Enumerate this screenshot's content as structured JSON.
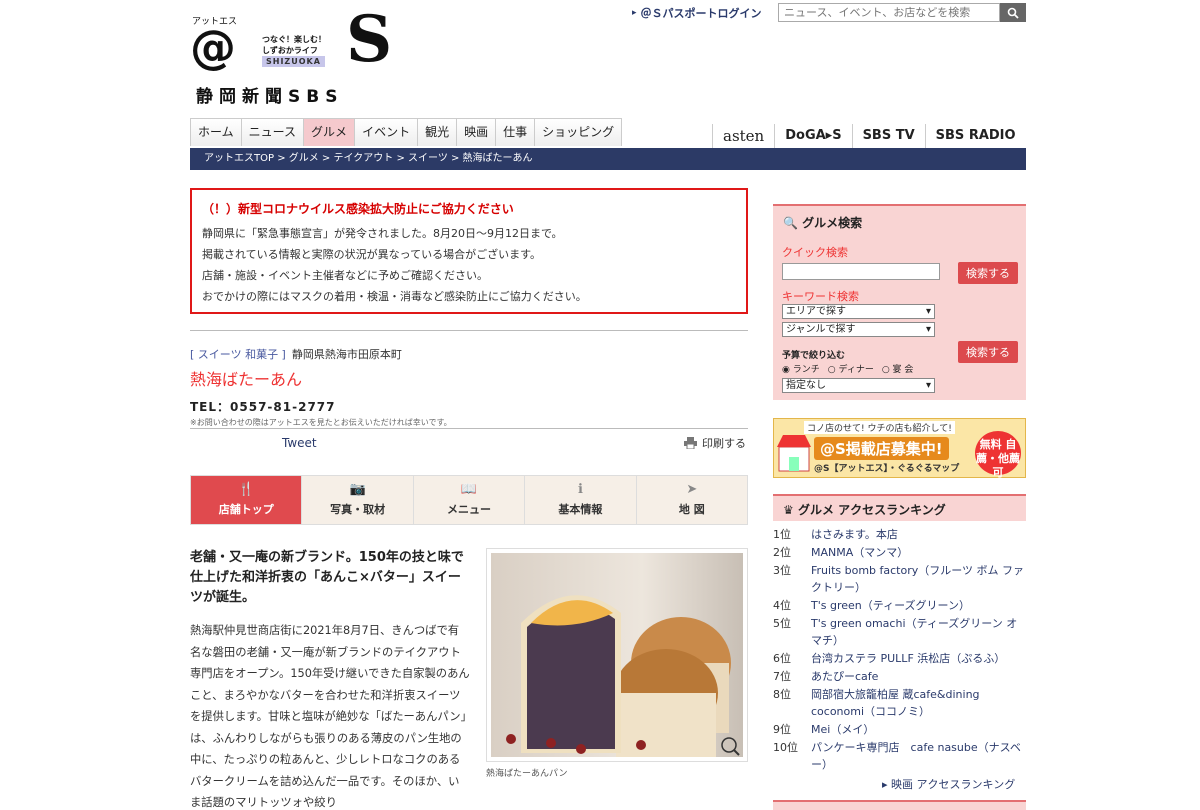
{
  "header": {
    "logo_at_small": "アットエス",
    "logo_at": "@",
    "tagline": "つなぐ！楽しむ！しずおかライフ",
    "logo_shizuoka": "SHIZUOKA",
    "logo_big_s": "S",
    "logo_sub": "静岡新聞SBS",
    "passport_link": "＠Ｓパスポートログイン",
    "search_placeholder": "ニュース、イベント、お店などを検索"
  },
  "nav": [
    "ホーム",
    "ニュース",
    "グルメ",
    "イベント",
    "観光",
    "映画",
    "仕事",
    "ショッピング"
  ],
  "nav_active": "グルメ",
  "media_links": [
    "asten",
    "DoGA▸S",
    "SBS TV",
    "SBS RADIO"
  ],
  "breadcrumb": "アットエスTOP > グルメ > テイクアウト > スイーツ > 熱海ばたーあん",
  "notice": {
    "title": "（！）新型コロナウイルス感染拡大防止にご協力ください",
    "lines": [
      "静岡県に「緊急事態宣言」が発令されました。8月20日〜9月12日まで。",
      "掲載されている情報と実際の状況が異なっている場合がございます。",
      "店舗・施設・イベント主催者などに予めご確認ください。",
      "おでかけの際にはマスクの着用・検温・消毒など感染防止にご協力ください。"
    ]
  },
  "shop": {
    "category": "[ スイーツ 和菓子 ]",
    "address": "静岡県熱海市田原本町",
    "name": "熱海ばたーあん",
    "tel": "TEL：0557-81-2777",
    "note": "※お問い合わせの際はアットエスを見たとお伝えいただければ幸いです。"
  },
  "share": {
    "tweet": "Tweet",
    "print": "印刷する"
  },
  "tabs": [
    {
      "label": "店舗トップ",
      "icon": "utensils-icon",
      "glyph": "🍴"
    },
    {
      "label": "写真・取材",
      "icon": "camera-icon",
      "glyph": "📷"
    },
    {
      "label": "メニュー",
      "icon": "book-icon",
      "glyph": "📖"
    },
    {
      "label": "基本情報",
      "icon": "info-icon",
      "glyph": "ℹ"
    },
    {
      "label": "地 図",
      "icon": "compass-icon",
      "glyph": "➤"
    }
  ],
  "article": {
    "lead": "老舗・又一庵の新ブランド。150年の技と味で仕上げた和洋折衷の「あんこ×バター」スイーツが誕生。",
    "body": "熱海駅仲見世商店街に2021年8月7日、きんつばで有名な磐田の老舗・又一庵が新ブランドのテイクアウト専門店をオープン。150年受け継いできた自家製のあんこと、まろやかなバターを合わせた和洋折衷スイーツを提供します。甘味と塩味が絶妙な「ばたーあんパン」は、ふんわりしながらも張りのある薄皮のパン生地の中に、たっぷりの粒あんと、少しレトロなコクのあるバタークリームを詰め込んだ一品です。そのほか、いま話題のマリトッツォや絞り",
    "photo_caption": "熱海ばたーあんパン"
  },
  "sidebar": {
    "search": {
      "title": "グルメ検索",
      "quick_label": "クイック検索",
      "keyword_label": "キーワード検索",
      "search_button": "検索する",
      "area_select": "エリアで探す",
      "genre_select": "ジャンルで探す",
      "budget_label": "予算で絞り込む",
      "radio": [
        "ランチ",
        "ディナー",
        "宴 会"
      ],
      "budget_select": "指定なし"
    },
    "banner": {
      "line1": "コノ店のせて! ウチの店も紹介して!",
      "line2": "@S掲載店募集中!",
      "line3": "@S【アットエス】・ぐるぐるマップ",
      "badge": "無料 自薦・他薦可"
    },
    "ranking_title": "グルメ アクセスランキング",
    "ranking": [
      {
        "no": "1位",
        "name": "はさみます。本店"
      },
      {
        "no": "2位",
        "name": "MANMA（マンマ）"
      },
      {
        "no": "3位",
        "name": "Fruits bomb factory（フルーツ ボム ファクトリー）"
      },
      {
        "no": "4位",
        "name": "T's green（ティーズグリーン）"
      },
      {
        "no": "5位",
        "name": "T's green omachi（ティーズグリーン オマチ）"
      },
      {
        "no": "6位",
        "name": "台湾カステラ PULLF 浜松店（ぷるふ）"
      },
      {
        "no": "7位",
        "name": "あたぴーcafe"
      },
      {
        "no": "8位",
        "name": "岡部宿大旅籠柏屋 蔵cafe&dining coconomi（ココノミ）"
      },
      {
        "no": "9位",
        "name": "Mei（メイ）"
      },
      {
        "no": "10位",
        "name": "パンケーキ専門店　cafe nasube（ナスベー）"
      }
    ],
    "movie_ranking_link": "映画 アクセスランキング"
  }
}
